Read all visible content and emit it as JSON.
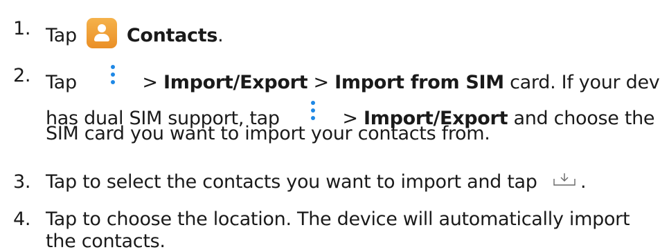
{
  "steps": [
    {
      "number": "1.",
      "tap": "Tap",
      "icon": "contacts-app-icon",
      "target": "Contacts",
      "end": "."
    },
    {
      "number": "2.",
      "tap": "Tap",
      "icon": "overflow-menu-icon",
      "sep1": ">",
      "item1": "Import/Export",
      "sep2": ">",
      "item2": "Import from SIM",
      "rest1": "card. If your device",
      "line2_pre": "has dual SIM support, tap",
      "sep3": ">",
      "item3": "Import/Export",
      "rest2": "and choose the",
      "line3": "SIM card you want to import your contacts from."
    },
    {
      "number": "3.",
      "text": "Tap to select the contacts you want to import and tap",
      "icon": "import-tray-icon",
      "end": "."
    },
    {
      "number": "4.",
      "line1": "Tap to choose the location. The device will automatically import",
      "line2": "the contacts."
    }
  ],
  "colors": {
    "text": "#1a1a1a",
    "menu_dots": "#1e88e5",
    "contacts_icon": "#f0a035",
    "import_icon": "#666666"
  }
}
